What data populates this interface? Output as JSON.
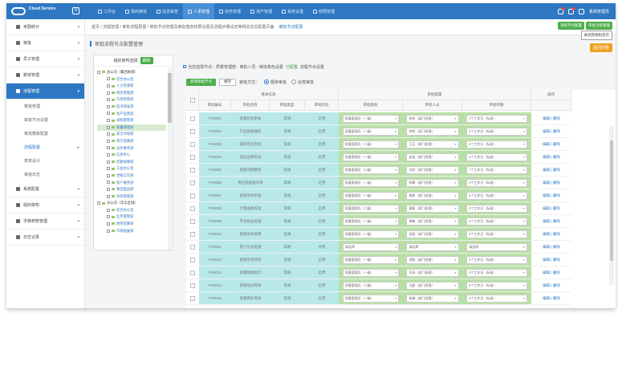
{
  "brand": {
    "name": "Cloud Service"
  },
  "nav": {
    "tabs": [
      "工作台",
      "我的审批",
      "信息审查",
      "人事管理",
      "财务管理",
      "资产管理",
      "系统设置",
      "权限管理"
    ],
    "active": 3
  },
  "user": {
    "name": "系统管理员"
  },
  "sidebar": {
    "items": [
      {
        "label": "考勤统计"
      },
      {
        "label": "审批"
      },
      {
        "label": "员工管理"
      },
      {
        "label": "薪资管理"
      },
      {
        "label": "流程管理",
        "active": true
      }
    ],
    "subitems": [
      "审批管理",
      "审批节点设置",
      "审批模板配置",
      "流程配置",
      "表单设计",
      "审批日志"
    ],
    "subitems_selected": 3,
    "items_after": [
      {
        "label": "系统配置"
      },
      {
        "label": "组织架构"
      },
      {
        "label": "字典参数管理"
      },
      {
        "label": "日志记录"
      }
    ]
  },
  "crumbs": {
    "text": "首页 / 流程管理 / 审批流程配置 / 审批节点管理及审批角色权限设置及流程步骤设定等相关信息配置页面",
    "current": "审批节点配置"
  },
  "tabs_right": {
    "pill1": "流程节点配置",
    "pill2": "审批流程管理",
    "close": "关闭其他标签页"
  },
  "orange_button": "返回列表",
  "page_title": "审批流程节点配置管理",
  "tree": {
    "header": "组织架构选择",
    "header_btn": "刷新",
    "nodes": [
      {
        "label": "总公司（集团本部）",
        "level": 0
      },
      {
        "label": "综合办公室",
        "level": 1
      },
      {
        "label": "人力资源部",
        "level": 1
      },
      {
        "label": "财务管理部",
        "level": 1
      },
      {
        "label": "市场营销部",
        "level": 1
      },
      {
        "label": "技术研发部",
        "level": 1
      },
      {
        "label": "生产运营部",
        "level": 1
      },
      {
        "label": "采购管理部",
        "level": 1
      },
      {
        "label": "质量管理部",
        "level": 1,
        "selected": true
      },
      {
        "label": "安全环保部",
        "level": 1
      },
      {
        "label": "审计监察部",
        "level": 1
      },
      {
        "label": "法务事务部",
        "level": 1
      },
      {
        "label": "信息中心",
        "level": 1
      },
      {
        "label": "后勤保障部",
        "level": 1
      },
      {
        "label": "工会办公室",
        "level": 1
      },
      {
        "label": "党群工作部",
        "level": 1
      },
      {
        "label": "客户服务部",
        "level": 1
      },
      {
        "label": "物流配送部",
        "level": 1
      },
      {
        "label": "项目管理部",
        "level": 1
      },
      {
        "label": "分公司（华东区域）",
        "level": 0
      },
      {
        "label": "综合办公室",
        "level": 1
      },
      {
        "label": "业务管理部",
        "level": 1
      },
      {
        "label": "财务结算部",
        "level": 1
      },
      {
        "label": "市场拓展部",
        "level": 1
      }
    ]
  },
  "toolbar": {
    "info": "当前选择节点：质量管理部 · 审批人员 · 审批角色设置",
    "green_text": "已配置",
    "info2": "流程节点设置"
  },
  "actions": {
    "add": "新增审批节点",
    "save": "保存",
    "mode_label": "审批方式：",
    "radio1": "顺序审批",
    "radio2": "会签审批"
  },
  "table": {
    "group_headers": {
      "base": "基本信息",
      "config": "审批配置",
      "ops": "操作"
    },
    "headers": [
      "审批编号",
      "审批名称",
      "审批类型",
      "审批状态",
      "审批角色",
      "审批人员",
      "审批时限",
      "操作"
    ],
    "rows": [
      {
        "id": "PX0001",
        "name": "质量检验审核",
        "type": "常规",
        "status": "启用",
        "role": "质量管理员（一级）",
        "person": "张伟（部门经理）",
        "limit": "3个工作日（标准）",
        "ops": "编辑 | 删除"
      },
      {
        "id": "PX0002",
        "name": "产品质量抽检",
        "type": "常规",
        "status": "启用",
        "role": "质量管理员（一级）",
        "person": "李明（部门经理）",
        "limit": "3个工作日（标准）",
        "ops": "编辑 | 删除"
      },
      {
        "id": "PX0003",
        "name": "来料检验审批",
        "type": "常规",
        "status": "启用",
        "role": "质量管理员（二级）",
        "person": "王芳（部门经理）",
        "limit": "5个工作日（标准）",
        "ops": "编辑 | 删除"
      },
      {
        "id": "PX0004",
        "name": "成品出库检验",
        "type": "常规",
        "status": "启用",
        "role": "质量管理员（一级）",
        "person": "赵强（部门经理）",
        "limit": "3个工作日（标准）",
        "ops": "编辑 | 删除"
      },
      {
        "id": "PX0005",
        "name": "质量问题整改",
        "type": "常规",
        "status": "启用",
        "role": "质量管理员（二级）",
        "person": "刘洋（部门经理）",
        "limit": "7个工作日（标准）",
        "ops": "编辑 | 删除"
      },
      {
        "id": "PX0006",
        "name": "供应商质量评审",
        "type": "常规",
        "status": "启用",
        "role": "质量管理员（一级）",
        "person": "陈静（部门经理）",
        "limit": "3个工作日（标准）",
        "ops": "编辑 | 删除"
      },
      {
        "id": "PX0007",
        "name": "质量体系审核",
        "type": "常规",
        "status": "启用",
        "role": "质量管理员（一级）",
        "person": "杨帆（部门经理）",
        "limit": "5个工作日（标准）",
        "ops": "编辑 | 删除"
      },
      {
        "id": "PX0008",
        "name": "计量器具校准",
        "type": "常规",
        "status": "启用",
        "role": "质量管理员（二级）",
        "person": "黄磊（部门经理）",
        "limit": "3个工作日（标准）",
        "ops": "编辑 | 删除"
      },
      {
        "id": "PX0009",
        "name": "不合格品处理",
        "type": "常规",
        "status": "启用",
        "role": "质量管理员（一级）",
        "person": "周敏（部门经理）",
        "limit": "3个工作日（标准）",
        "ops": "编辑 | 删除"
      },
      {
        "id": "PX0010",
        "name": "质量成本核算",
        "type": "常规",
        "status": "启用",
        "role": "质量管理员（一级）",
        "person": "吴刚（部门经理）",
        "limit": "5个工作日（标准）",
        "ops": "编辑 | 删除"
      },
      {
        "id": "PX0011",
        "name": "客户投诉处理",
        "type": "常规",
        "status": "停用",
        "role": "请选择",
        "person": "请选择",
        "limit": "请选择",
        "ops": "编辑 | 删除"
      },
      {
        "id": "PX0012",
        "name": "质量改进项目",
        "type": "常规",
        "status": "启用",
        "role": "质量管理员（一级）",
        "person": "郑丽（部门经理）",
        "limit": "3个工作日（标准）",
        "ops": "编辑 | 删除"
      },
      {
        "id": "PX0013",
        "name": "质量数据统计",
        "type": "常规",
        "status": "启用",
        "role": "质量管理员（一级）",
        "person": "孙涛（部门经理）",
        "limit": "3个工作日（标准）",
        "ops": "编辑 | 删除"
      },
      {
        "id": "PX0014",
        "name": "质量培训考核",
        "type": "常规",
        "status": "启用",
        "role": "质量管理员（二级）",
        "person": "马超（部门经理）",
        "limit": "5个工作日（标准）",
        "ops": "编辑 | 删除"
      },
      {
        "id": "PX0015",
        "name": "质量目标考核",
        "type": "常规",
        "status": "启用",
        "role": "质量管理员（一级）",
        "person": "朱琳（部门经理）",
        "limit": "3个工作日（标准）",
        "ops": "编辑 | 删除"
      }
    ]
  },
  "colors": {
    "primary": "#2e78c3",
    "green": "#4cae4c",
    "cyan_col": "#b9e8e8",
    "green_col": "#b8e0a6",
    "orange": "#f0a020"
  }
}
